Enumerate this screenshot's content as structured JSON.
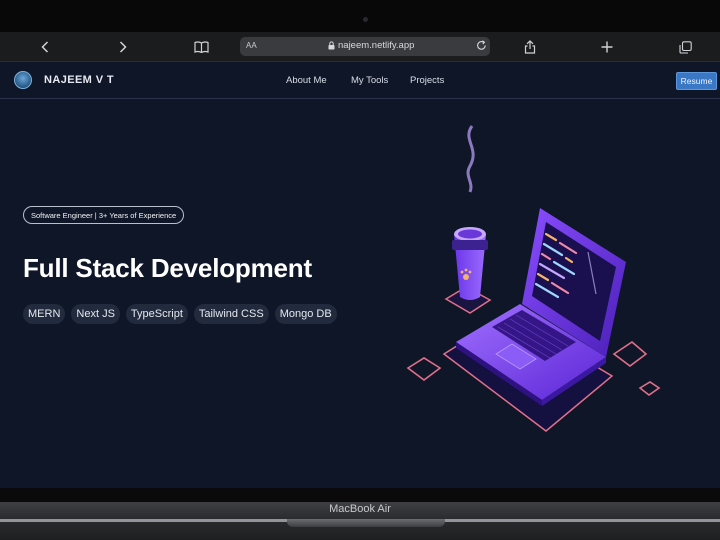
{
  "device": {
    "model_label": "MacBook Air"
  },
  "browser": {
    "text_size_label": "AA",
    "url": "najeem.netlify.app",
    "icons": [
      "back-icon",
      "forward-icon",
      "bookmarks-icon",
      "lock-icon",
      "reload-icon",
      "share-icon",
      "new-tab-icon",
      "tabs-icon"
    ]
  },
  "site": {
    "brand": "NAJEEM V T",
    "nav": [
      "About Me",
      "My Tools",
      "Projects"
    ],
    "resume_label": "Resume",
    "badge": "Software Engineer | 3+ Years of Experience",
    "headline": "Full Stack Development",
    "tags": [
      "MERN",
      "Next JS",
      "TypeScript",
      "Tailwind CSS",
      "Mongo DB"
    ],
    "colors": {
      "background": "#0f1628",
      "accent": "#3a78c6",
      "illustration_primary": "#7b3ff2",
      "illustration_outline": "#e0708a"
    }
  }
}
